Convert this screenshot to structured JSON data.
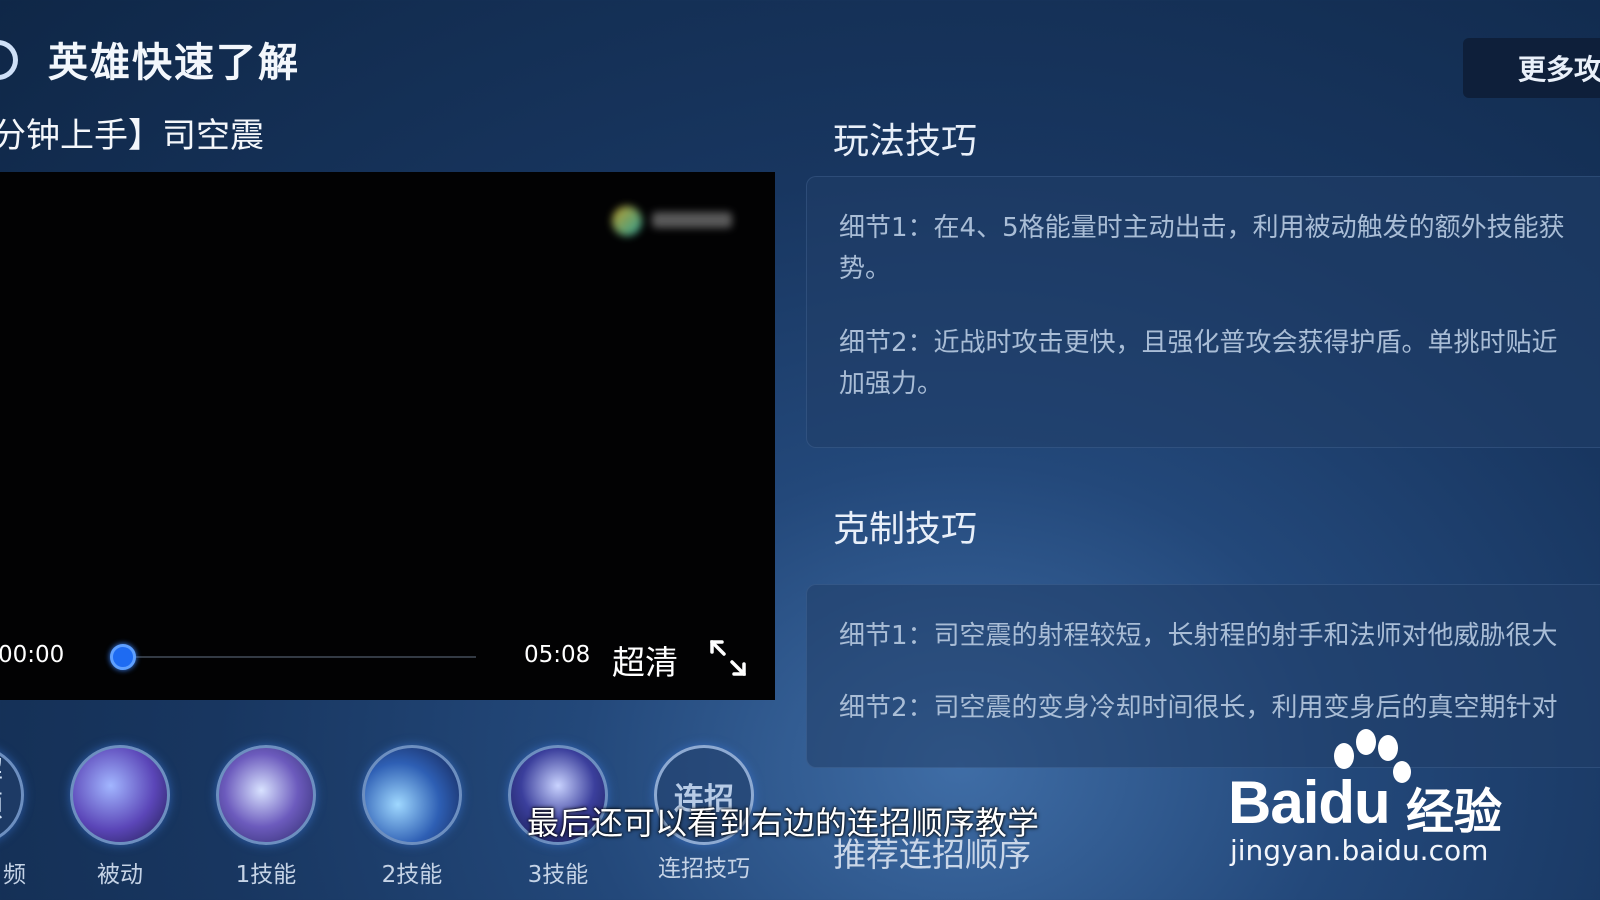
{
  "header": {
    "title": "英雄快速了解",
    "more_button": "更多攻"
  },
  "video": {
    "title": "分钟上手】司空震",
    "current_time": "00:00",
    "duration": "05:08",
    "quality": "超清",
    "progress": 0
  },
  "tips": {
    "play_title": "玩法技巧",
    "play_items": [
      "细节1：在4、5格能量时主动出击，利用被动触发的额外技能获",
      "势。",
      "细节2：近战时攻击更快，且强化普攻会获得护盾。单挑时贴近",
      "加强力。"
    ],
    "counter_title": "克制技巧",
    "counter_items": [
      "细节1：司空震的射程较短，长射程的射手和法师对他威胁很大",
      "细节2：司空震的变身冷却时间很长，利用变身后的真空期针对"
    ]
  },
  "skills": {
    "video_label": "频",
    "video_icon_text": "解\n频",
    "items": [
      {
        "label": "被动",
        "icon": "passive-skill-icon",
        "color": "#5b46b8"
      },
      {
        "label": "1技能",
        "icon": "skill1-icon",
        "color": "#6c5bbd"
      },
      {
        "label": "2技能",
        "icon": "skill2-icon",
        "color": "#2e5fb4"
      },
      {
        "label": "3技能",
        "icon": "skill3-icon",
        "color": "#3b3f9c"
      }
    ],
    "combo_icon_text": "连招",
    "combo_label": "连招技巧"
  },
  "subtitle": "最后还可以看到右边的连招顺序教学",
  "recommend": "推荐连招顺序",
  "watermark": {
    "brand": "Baidu",
    "product": "经验",
    "url": "jingyan.baidu.com"
  }
}
